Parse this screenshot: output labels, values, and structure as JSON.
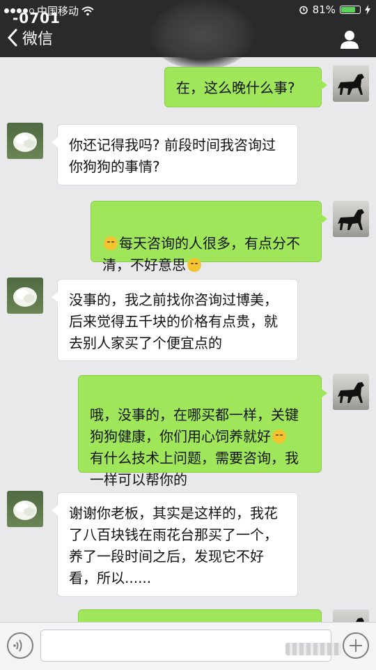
{
  "status_bar": {
    "carrier": "中国移动",
    "battery": "81%",
    "battery_level": 0.81,
    "overlay_code": "-0701"
  },
  "nav": {
    "back_label": "微信"
  },
  "messages": [
    {
      "side": "me",
      "text": "在，这么晚什么事?"
    },
    {
      "side": "them",
      "text": "你还记得我吗? 前段时间我咨询过\n你狗狗的事情?"
    },
    {
      "side": "me",
      "text_a": "每天咨询的人很多，有点分不\n清，不好意思"
    },
    {
      "side": "them",
      "text": "没事的，我之前找你咨询过博美，\n后来觉得五千块的价格有点贵，就\n去别人家买了个便宜点的"
    },
    {
      "side": "me",
      "text_a": "哦，没事的，在哪买都一样，关键\n狗狗健康，你们用心饲养就好",
      "text_b": "有什么技术上问题，需要咨询，我\n一样可以帮你的"
    },
    {
      "side": "them",
      "text": "谢谢你老板，其实是这样的，我花\n了八百块钱在雨花台那买了一个，\n养了一段时间之后，发现它不好\n看，所以......"
    }
  ],
  "colors": {
    "header_bg": "#2a2a2c",
    "chat_bg": "#e9e9ec",
    "my_bubble": "#9fe65a",
    "their_bubble": "#ffffff"
  },
  "icons": {
    "back": "chevron-left-icon",
    "profile": "person-icon",
    "voice": "voice-icon",
    "plus": "plus-icon",
    "emoji": "smiley-icon"
  }
}
